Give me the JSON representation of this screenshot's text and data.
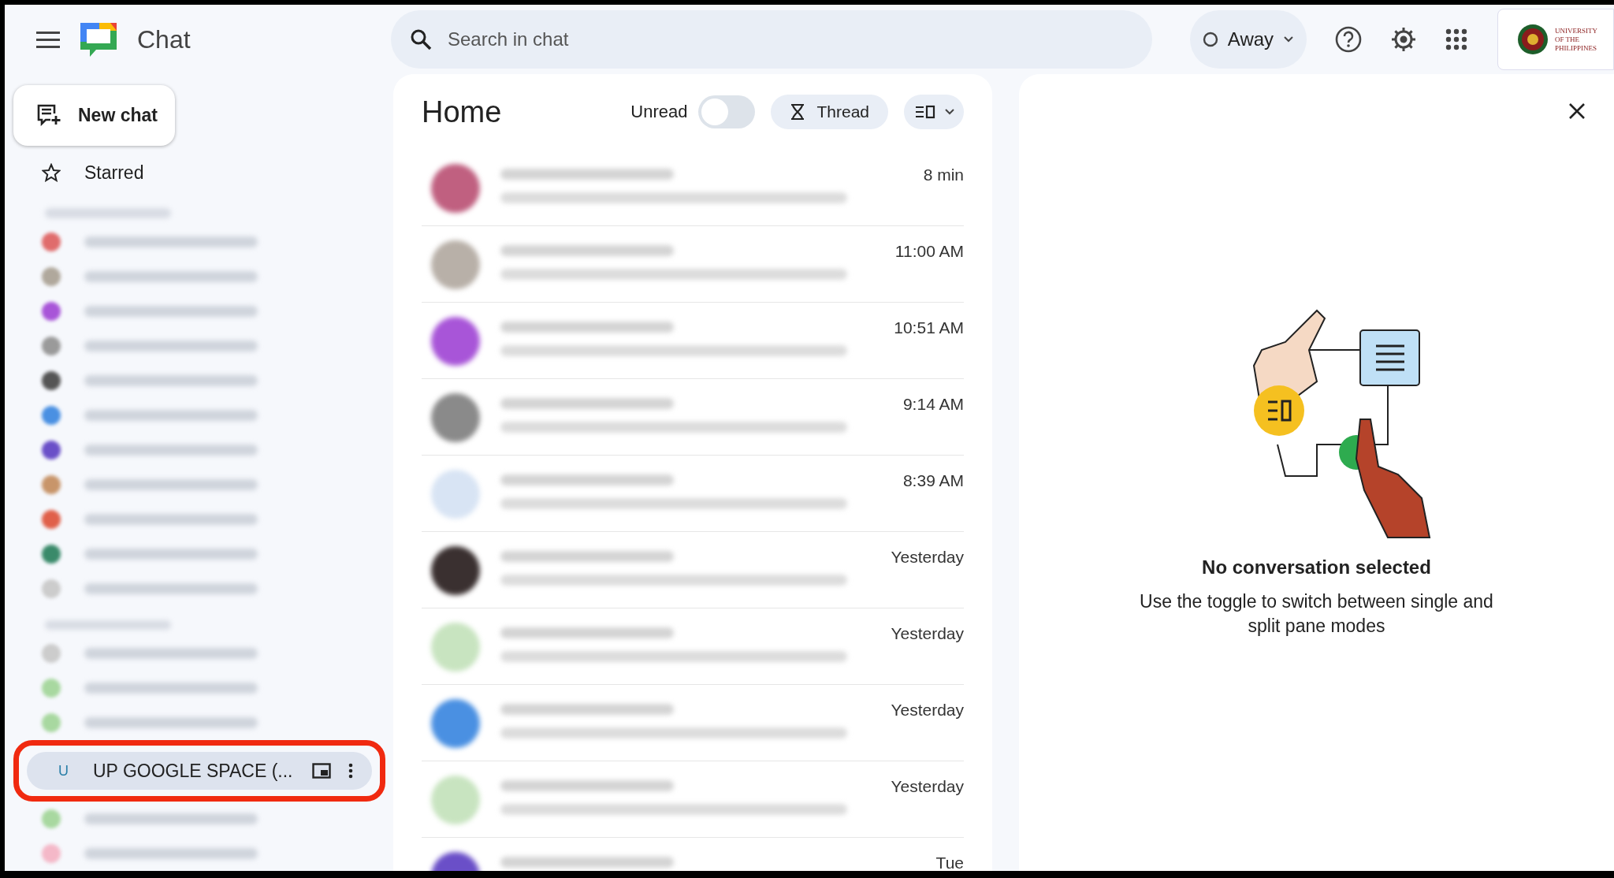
{
  "app": {
    "name": "Chat"
  },
  "search": {
    "placeholder": "Search in chat"
  },
  "status": {
    "label": "Away"
  },
  "org_logo": {
    "lines": [
      "UNIVERSITY",
      "OF THE",
      "PHILIPPINES"
    ]
  },
  "sidebar": {
    "new_chat": "New chat",
    "starred": "Starred",
    "direct_messages": [
      {
        "color": "#e06c6c"
      },
      {
        "color": "#b0a89c"
      },
      {
        "color": "#a855d8"
      },
      {
        "color": "#9a9a9a"
      },
      {
        "color": "#555555"
      },
      {
        "color": "#4a90e2"
      },
      {
        "color": "#6a4fc8"
      },
      {
        "color": "#c8956a"
      },
      {
        "color": "#e0604a"
      },
      {
        "color": "#3a8a6a"
      },
      {
        "color": "#cccccc"
      }
    ],
    "spaces": [
      {
        "kind": "blurred",
        "color": "#cccccc",
        "selected": false
      },
      {
        "kind": "blurred",
        "color": "#a8d8a0",
        "selected": false
      },
      {
        "kind": "blurred",
        "color": "#a8d8a0",
        "selected": false
      },
      {
        "kind": "space",
        "initial": "U",
        "label": "UP GOOGLE SPACE (...",
        "selected": true
      },
      {
        "kind": "blurred",
        "color": "#a8d8a0",
        "selected": false
      },
      {
        "kind": "blurred",
        "color": "#f4b8c8",
        "selected": false
      }
    ]
  },
  "home": {
    "title": "Home",
    "unread": {
      "label": "Unread",
      "on": false
    },
    "thread": "Thread",
    "conversations": [
      {
        "time": "8 min",
        "color": "#c06080"
      },
      {
        "time": "11:00 AM",
        "color": "#b8b0a8"
      },
      {
        "time": "10:51 AM",
        "color": "#a855d8"
      },
      {
        "time": "9:14 AM",
        "color": "#8a8a8a"
      },
      {
        "time": "8:39 AM",
        "color": "#d8e4f4"
      },
      {
        "time": "Yesterday",
        "color": "#3a3030"
      },
      {
        "time": "Yesterday",
        "color": "#c8e4c0"
      },
      {
        "time": "Yesterday",
        "color": "#4a90e2"
      },
      {
        "time": "Yesterday",
        "color": "#c8e4c0"
      },
      {
        "time": "Tue",
        "color": "#6a4fc8"
      }
    ]
  },
  "empty_state": {
    "title": "No conversation selected",
    "message": "Use the toggle to switch between single and split pane modes"
  }
}
